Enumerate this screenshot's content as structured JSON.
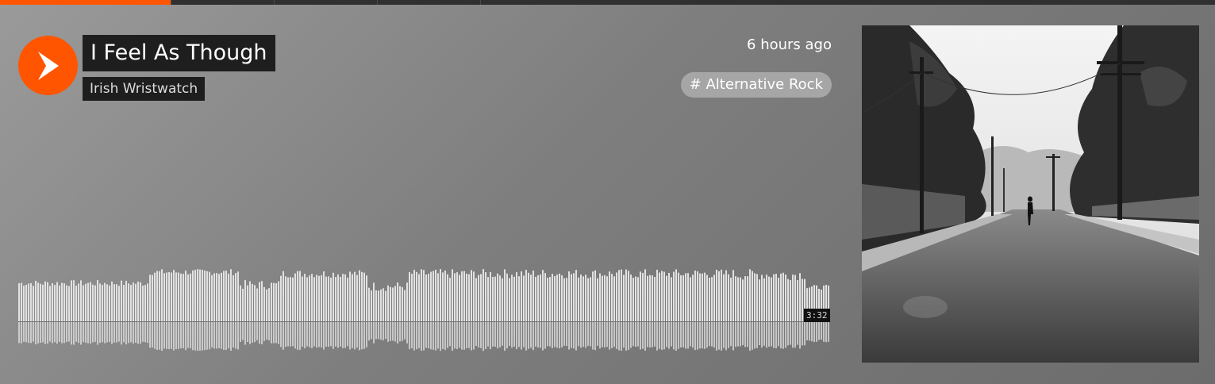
{
  "track": {
    "title": "I Feel As Though",
    "artist": "Irish Wristwatch",
    "posted": "6 hours ago",
    "tag": "# Alternative Rock",
    "duration": "3:32"
  },
  "colors": {
    "accent": "#ff5500",
    "label_bg": "#1e1e1e",
    "wave_bar": "#e2e2e2"
  },
  "icons": {
    "play": "play-icon"
  },
  "artwork": {
    "description_name": "black-and-white street photo artwork"
  }
}
